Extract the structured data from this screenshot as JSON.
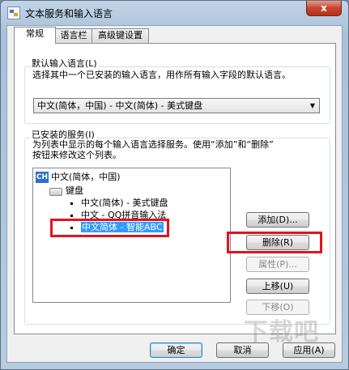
{
  "window": {
    "title": "文本服务和输入语言",
    "close_glyph": "x"
  },
  "tabs": [
    {
      "label": "常规",
      "active": true
    },
    {
      "label": "语言栏",
      "active": false
    },
    {
      "label": "高级键设置",
      "active": false
    }
  ],
  "default_language": {
    "legend": "默认输入语言(L)",
    "description": "选择其中一个已安装的输入语言，用作所有输入字段的默认语言。",
    "selected": "中文(简体，中国) - 中文(简体) - 美式键盘"
  },
  "installed_services": {
    "legend": "已安装的服务(I)",
    "description_line1": "为列表中显示的每个输入语言选择服务。使用“添加”和“删除”",
    "description_line2": "按钮来修改这个列表。",
    "tree": {
      "language_badge": "CH",
      "language": "中文(简体，中国)",
      "category": "键盘",
      "items": [
        {
          "label": "中文(简体) - 美式键盘",
          "selected": false
        },
        {
          "label": "中文 - QQ拼音输入法",
          "selected": false
        },
        {
          "label": "中文简体 - 智能ABC",
          "selected": true
        }
      ]
    },
    "buttons": {
      "add": "添加(D)...",
      "remove": "删除(R)",
      "properties": "属性(P)...",
      "move_up": "上移(U)",
      "move_down": "下移(O)"
    }
  },
  "footer": {
    "ok": "确定",
    "cancel": "取消",
    "apply": "应用(A)"
  },
  "watermark": "下载吧",
  "highlight_color": "#e0141f",
  "selection_color": "#3399ff"
}
